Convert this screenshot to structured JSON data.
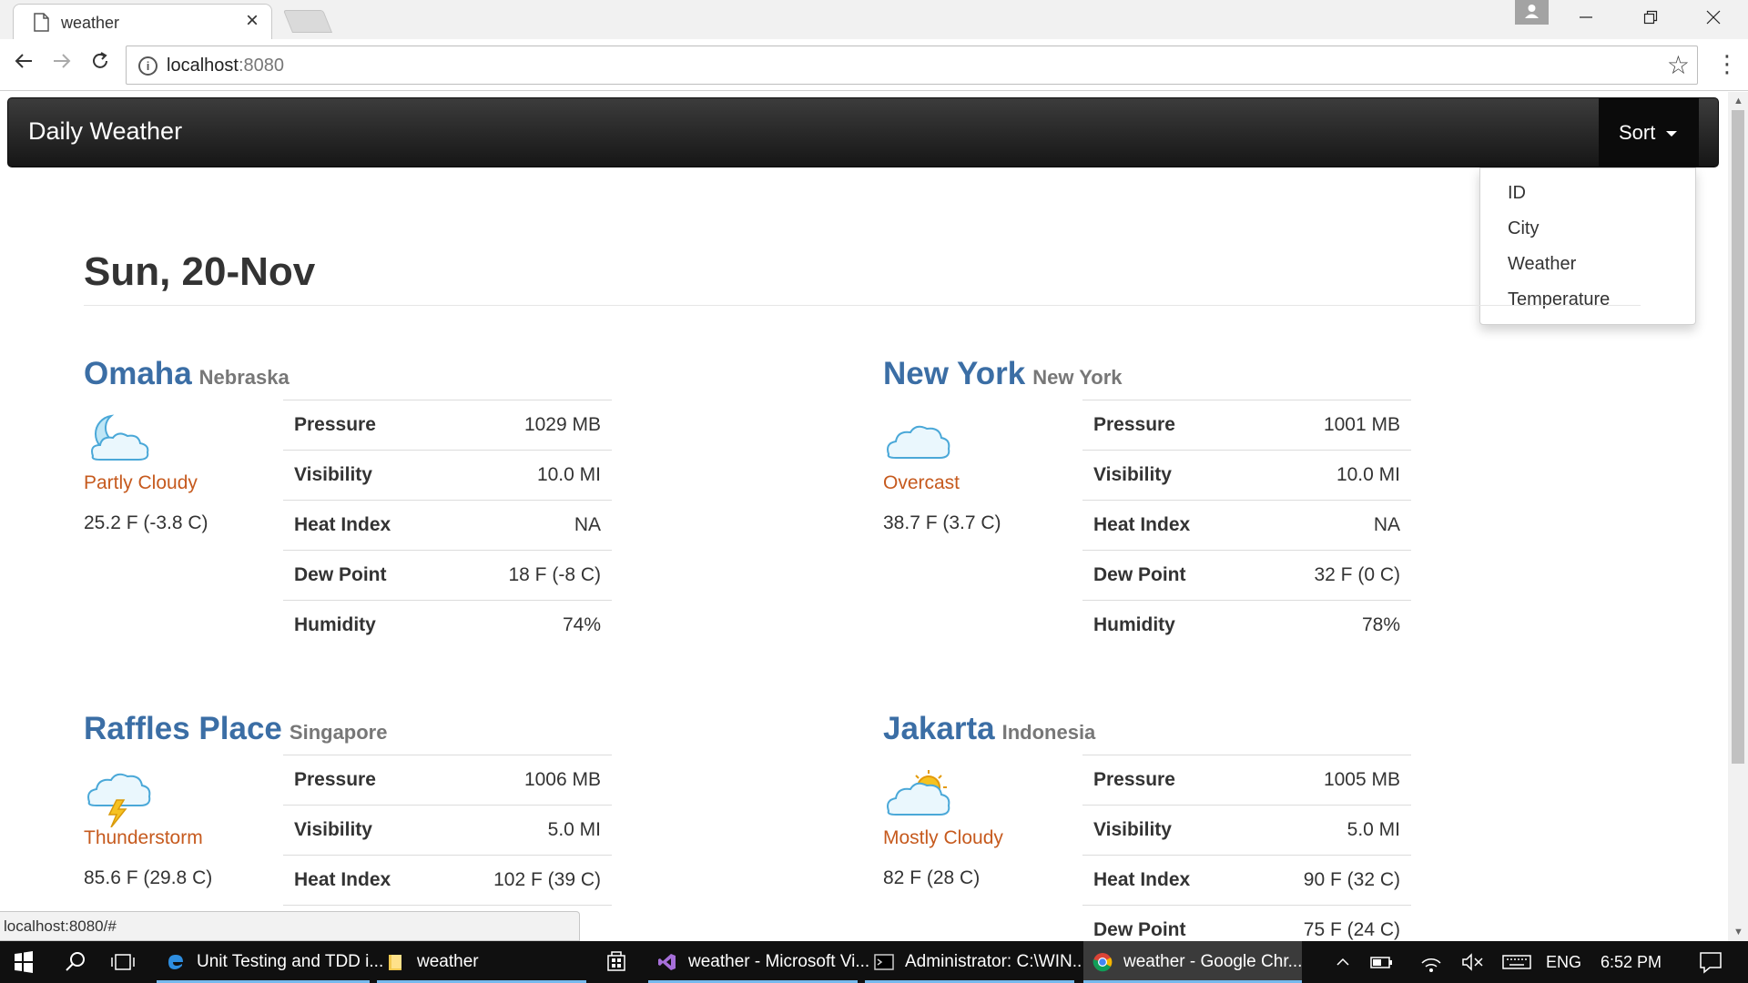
{
  "browser": {
    "tab_title": "weather",
    "tab_close": "×",
    "url_host": "localhost",
    "url_port": ":8080"
  },
  "navbar": {
    "brand": "Daily Weather",
    "sort_label": "Sort"
  },
  "sort_menu": {
    "items": [
      "ID",
      "City",
      "Weather",
      "Temperature"
    ]
  },
  "date_heading": "Sun, 20-Nov",
  "labels": {
    "pressure": "Pressure",
    "visibility": "Visibility",
    "heat_index": "Heat Index",
    "dew_point": "Dew Point",
    "humidity": "Humidity"
  },
  "cities": [
    {
      "city": "Omaha",
      "state": "Nebraska",
      "icon": "partly-cloudy-night-icon",
      "condition": "Partly Cloudy",
      "temp": "25.2 F (-3.8 C)",
      "pressure": "1029  MB",
      "visibility": "10.0  MI",
      "heat_index": "NA",
      "dew_point": "18 F (-8 C)",
      "humidity": "74%"
    },
    {
      "city": "New York",
      "state": "New York",
      "icon": "cloud-icon",
      "condition": "Overcast",
      "temp": "38.7 F (3.7 C)",
      "pressure": "1001  MB",
      "visibility": "10.0  MI",
      "heat_index": "NA",
      "dew_point": "32 F (0 C)",
      "humidity": "78%"
    },
    {
      "city": "Raffles Place",
      "state": "Singapore",
      "icon": "thunderstorm-icon",
      "condition": "Thunderstorm",
      "temp": "85.6 F (29.8 C)",
      "pressure": "1006  MB",
      "visibility": "5.0  MI",
      "heat_index": "102 F (39 C)",
      "dew_point": "",
      "humidity": ""
    },
    {
      "city": "Jakarta",
      "state": "Indonesia",
      "icon": "mostly-cloudy-icon",
      "condition": "Mostly Cloudy",
      "temp": "82 F (28 C)",
      "pressure": "1005  MB",
      "visibility": "5.0  MI",
      "heat_index": "90 F (32 C)",
      "dew_point": "75 F (24 C)",
      "humidity": ""
    }
  ],
  "status_url": "localhost:8080/#",
  "taskbar": {
    "apps": [
      {
        "label": "Unit Testing and TDD i...",
        "icon": "edge-icon"
      },
      {
        "label": "weather",
        "icon": "folder-icon"
      },
      {
        "label": "weather - Microsoft Vi...",
        "icon": "visual-studio-icon"
      },
      {
        "label": "Administrator: C:\\WIN...",
        "icon": "cmd-icon"
      },
      {
        "label": "weather - Google Chr...",
        "icon": "chrome-icon"
      }
    ],
    "language": "ENG",
    "time": "6:52 PM"
  }
}
